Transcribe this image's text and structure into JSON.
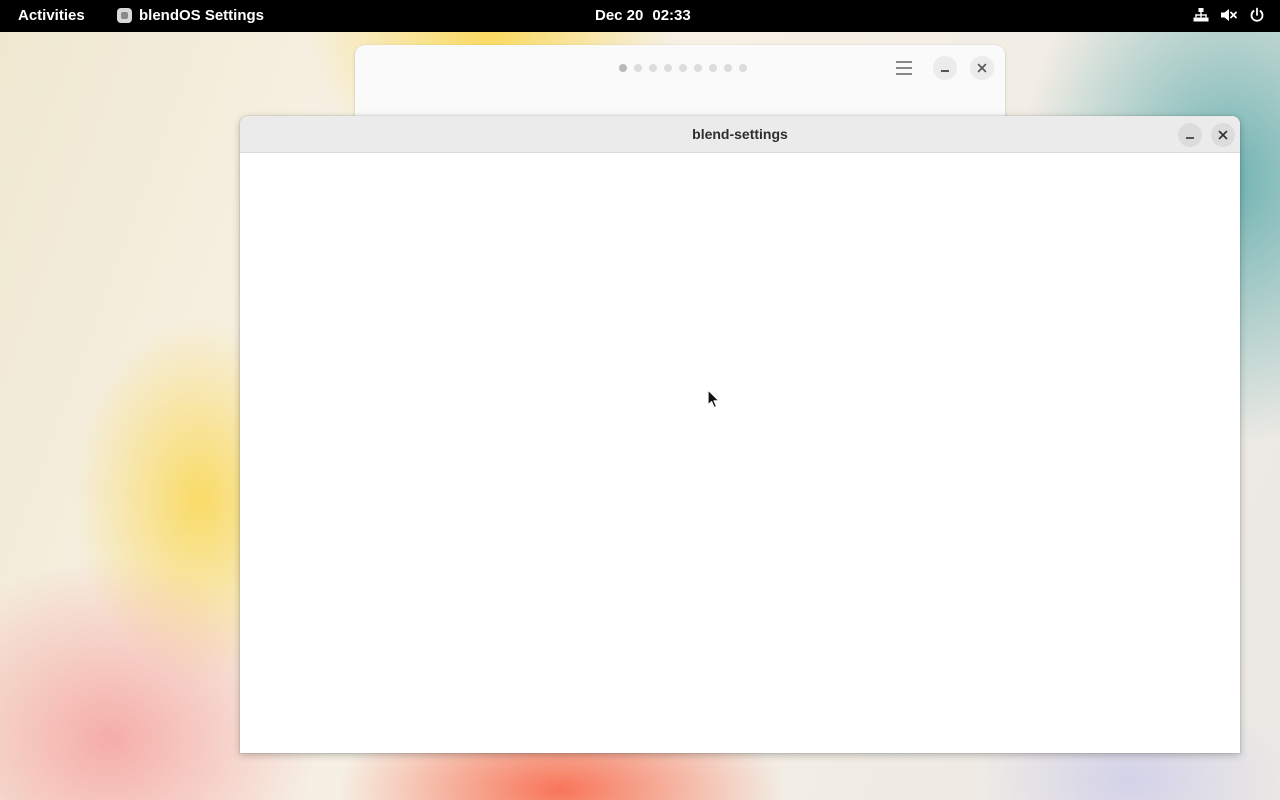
{
  "topbar": {
    "activities": "Activities",
    "app_name": "blendOS Settings",
    "date": "Dec 20",
    "time": "02:33",
    "tray_icons": [
      "network-wired-icon",
      "audio-muted-icon",
      "power-icon"
    ]
  },
  "background_window": {
    "page_count": 9,
    "active_page": 1,
    "icons": [
      "menu-icon",
      "minimize-icon",
      "close-icon"
    ]
  },
  "main_window": {
    "title": "blend-settings",
    "icons": [
      "minimize-icon",
      "close-icon"
    ]
  },
  "colors": {
    "topbar": "#000000",
    "titlebar": "#ebebeb",
    "window_bg": "#ffffff"
  }
}
